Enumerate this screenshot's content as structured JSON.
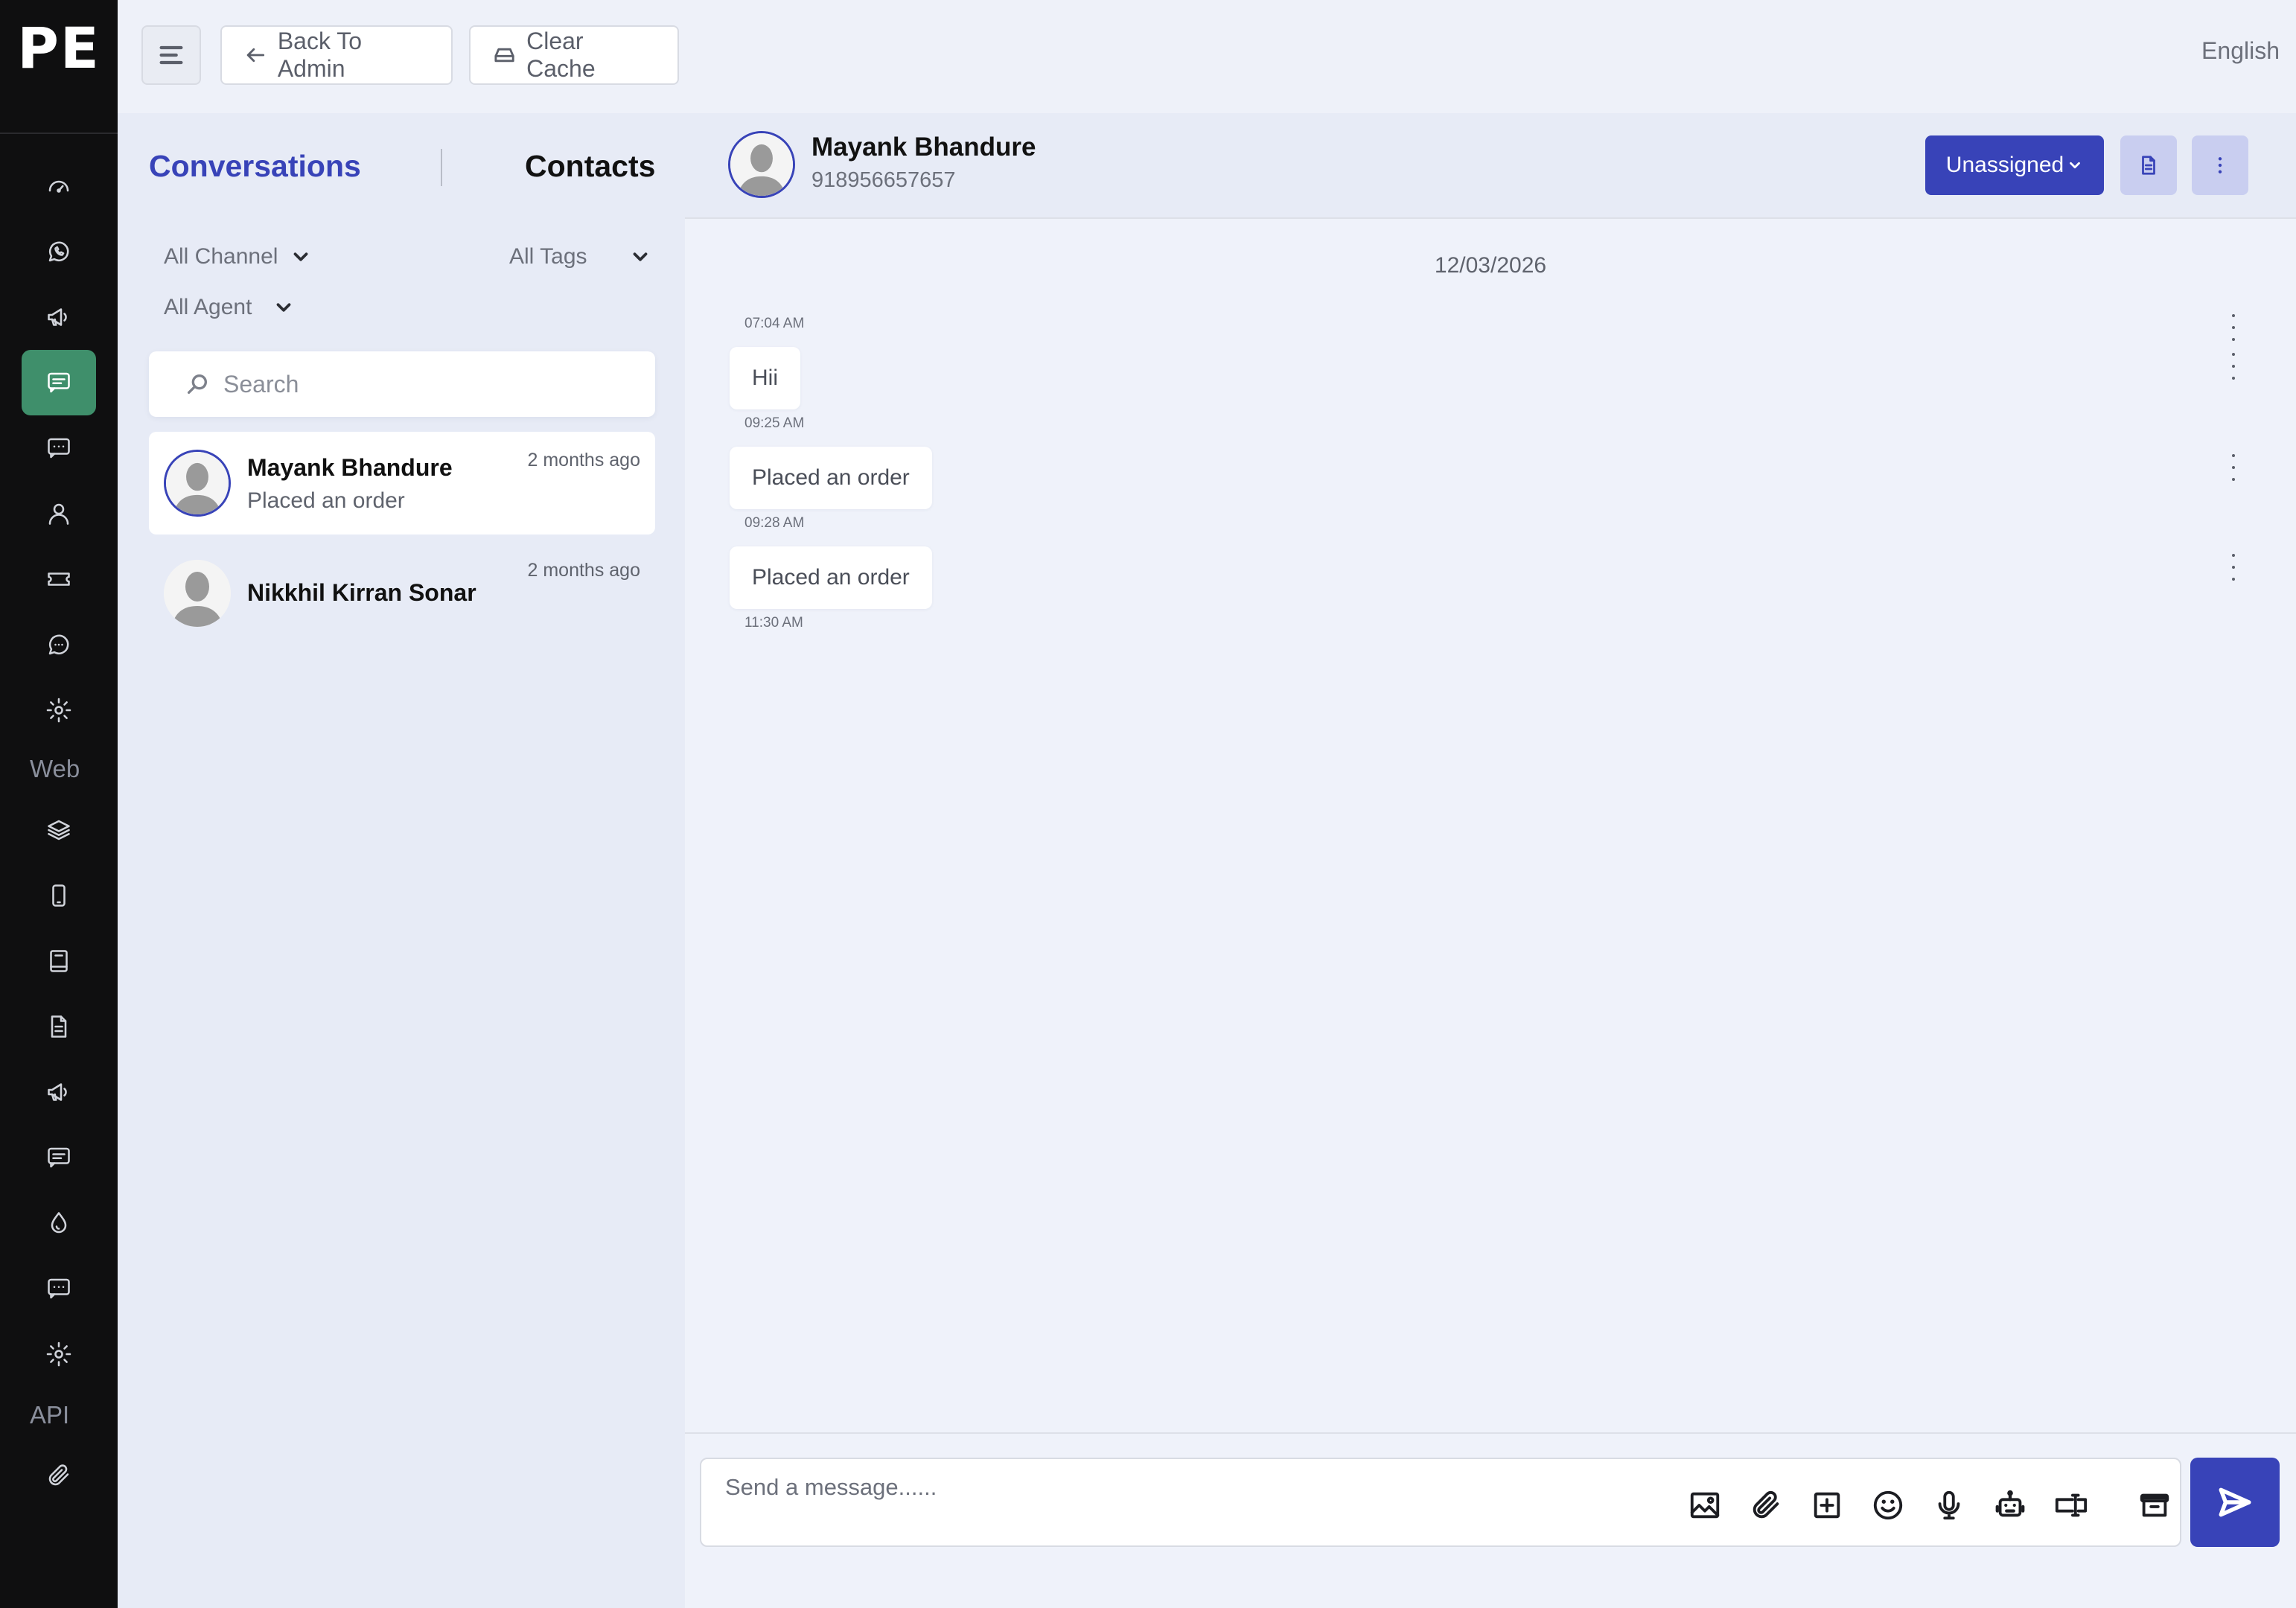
{
  "app": {
    "logo": "PE",
    "brand_color": "#3843b8",
    "active_color": "#3f8f6b"
  },
  "sidebar": {
    "items": [
      {
        "icon": "dashboard-icon"
      },
      {
        "icon": "whatsapp-icon"
      },
      {
        "icon": "megaphone-icon"
      },
      {
        "icon": "chat-icon",
        "active": true
      },
      {
        "icon": "message-dots-icon"
      },
      {
        "icon": "user-icon"
      },
      {
        "icon": "ticket-icon"
      },
      {
        "icon": "bot-chat-icon"
      },
      {
        "icon": "gear-icon"
      }
    ],
    "section_web": "Web",
    "web_items": [
      {
        "icon": "layers-icon"
      },
      {
        "icon": "mobile-icon"
      },
      {
        "icon": "book-icon"
      },
      {
        "icon": "document-icon"
      },
      {
        "icon": "megaphone-icon"
      },
      {
        "icon": "message-icon"
      },
      {
        "icon": "drop-icon"
      },
      {
        "icon": "message-dots-icon"
      },
      {
        "icon": "gear-icon"
      }
    ],
    "section_api": "API",
    "api_items": [
      {
        "icon": "paperclip-icon"
      }
    ]
  },
  "topbar": {
    "back_label": "Back To Admin",
    "clear_cache_label": "Clear Cache",
    "language": "English"
  },
  "list": {
    "tab_conversations": "Conversations",
    "tab_contacts": "Contacts",
    "filter_channel": "All Channel",
    "filter_tags": "All Tags",
    "filter_agent": "All Agent",
    "search_placeholder": "Search",
    "contacts": [
      {
        "name": "Mayank Bhandure",
        "preview": "Placed an order",
        "time": "2 months ago",
        "selected": true
      },
      {
        "name": "Nikkhil Kirran Sonar",
        "preview": "",
        "time": "2 months ago",
        "selected": false
      }
    ]
  },
  "chat": {
    "contact_name": "Mayank Bhandure",
    "contact_phone": "918956657657",
    "assign_label": "Unassigned",
    "date": "12/03/2026",
    "messages": [
      {
        "time": "07:04 AM",
        "text": ""
      },
      {
        "time": "09:25 AM",
        "text": "Hii"
      },
      {
        "time": "09:28 AM",
        "text": "Placed an order"
      },
      {
        "time": "11:30 AM",
        "text": "Placed an order"
      }
    ],
    "composer_placeholder": "Send a message......"
  }
}
